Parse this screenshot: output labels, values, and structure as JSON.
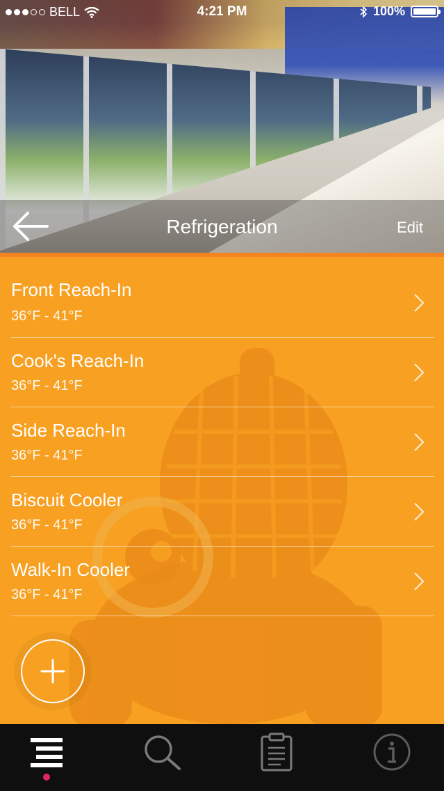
{
  "status_bar": {
    "carrier": "BELL",
    "time": "4:21 PM",
    "battery": "100%"
  },
  "nav": {
    "title": "Refrigeration",
    "edit_label": "Edit"
  },
  "units": [
    {
      "name": "Front Reach-In",
      "range": "36°F - 41°F"
    },
    {
      "name": "Cook's Reach-In",
      "range": "36°F - 41°F"
    },
    {
      "name": "Side Reach-In",
      "range": "36°F - 41°F"
    },
    {
      "name": "Biscuit Cooler",
      "range": "36°F - 41°F"
    },
    {
      "name": "Walk-In Cooler",
      "range": "36°F - 41°F"
    }
  ],
  "colors": {
    "background": "#F7A021",
    "tabbar": "#0f0f10",
    "active_indicator": "#e0246a"
  },
  "tabs": [
    {
      "icon": "list-icon",
      "active": true
    },
    {
      "icon": "search-icon",
      "active": false
    },
    {
      "icon": "clipboard-icon",
      "active": false
    },
    {
      "icon": "info-icon",
      "active": false
    }
  ]
}
